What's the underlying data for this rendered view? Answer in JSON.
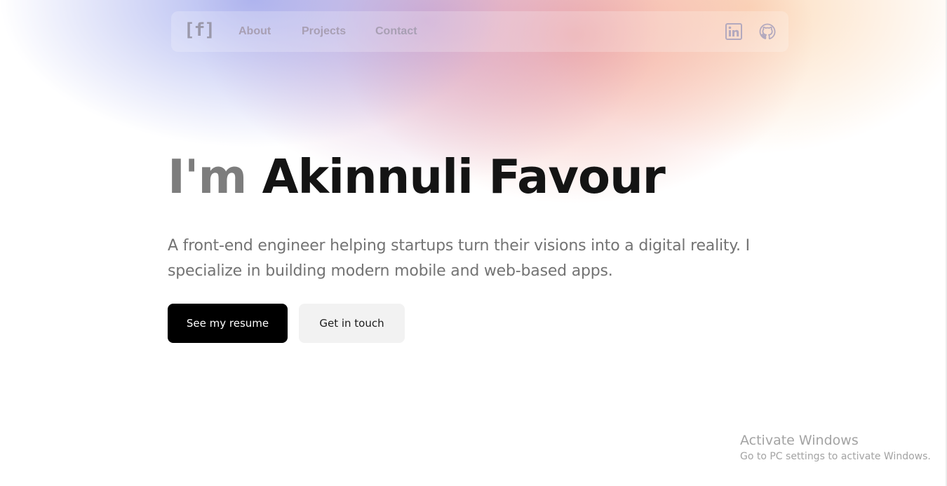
{
  "nav": {
    "logo": "[f]",
    "links": [
      "About",
      "Projects",
      "Contact"
    ],
    "social_icons": [
      "linkedin-icon",
      "github-icon"
    ]
  },
  "hero": {
    "title_prefix": "I'm ",
    "title_name": "Akinnuli Favour",
    "description": "A front-end engineer helping startups turn their visions into a digital reality. I specialize in building modern mobile and web-based apps.",
    "primary_button": "See my resume",
    "secondary_button": "Get in touch"
  },
  "watermark": {
    "title": "Activate Windows",
    "subtitle": "Go to PC settings to activate Windows."
  },
  "colors": {
    "primary_button_bg": "#000000",
    "secondary_button_bg": "#f2f2f2",
    "title_prefix": "#7d7d7d",
    "title_name": "#141414"
  }
}
